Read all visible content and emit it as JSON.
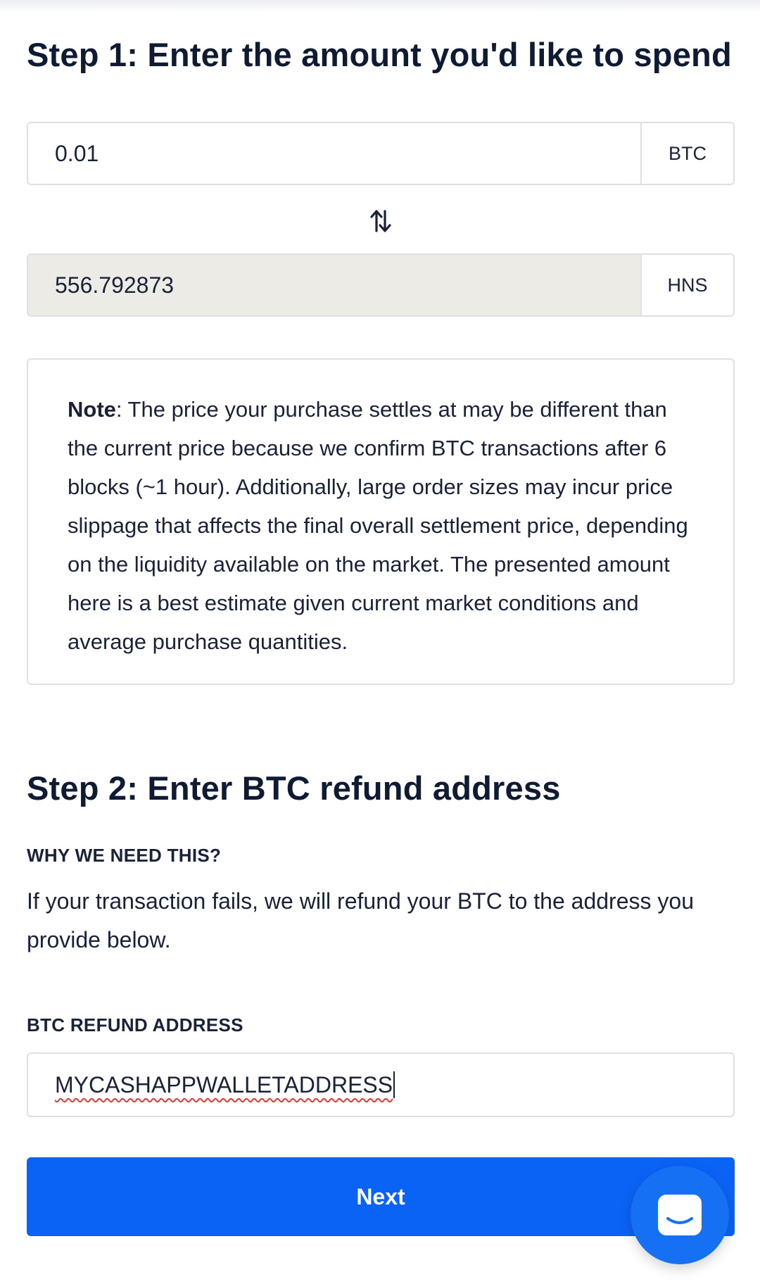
{
  "step1": {
    "title": "Step 1: Enter the amount you'd like to spend",
    "spend": {
      "value": "0.01",
      "unit": "BTC"
    },
    "swap_icon": "swap-vertical-arrows-icon",
    "receive": {
      "value": "556.792873",
      "unit": "HNS"
    },
    "note": {
      "label": "Note",
      "text": ": The price your purchase settles at may be different than the current price because we confirm BTC transactions after 6 blocks (~1 hour). Additionally, large order sizes may incur price slippage that affects the final overall settlement price, depending on the liquidity available on the market. The presented amount here is a best estimate given current market conditions and average purchase quantities."
    }
  },
  "step2": {
    "title": "Step 2: Enter BTC refund address",
    "why_label": "WHY WE NEED THIS?",
    "why_text": "If your transaction fails, we will refund your BTC to the address you provide below.",
    "address_label": "BTC REFUND ADDRESS",
    "address_value": "MYCASHAPPWALLETADDRESS"
  },
  "next_button": {
    "label": "Next"
  },
  "chat_widget": {
    "icon": "chat-bubble-icon",
    "color": "#1570f3"
  },
  "colors": {
    "primary": "#0b63f6",
    "text": "#1a2238",
    "readonly_bg": "#ecebe6",
    "border": "#dde0e6"
  }
}
